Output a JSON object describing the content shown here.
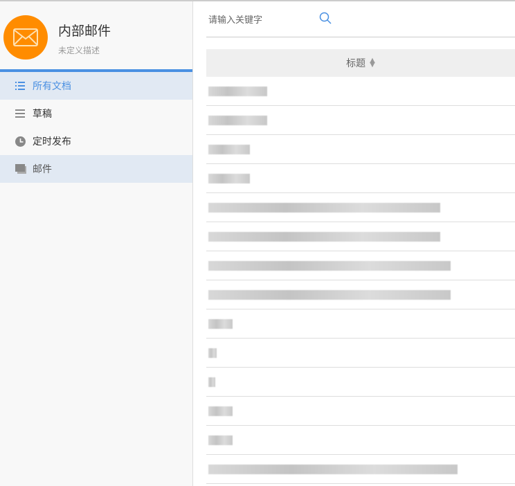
{
  "app": {
    "title": "内部邮件",
    "description": "未定义描述"
  },
  "sidebar": {
    "items": [
      {
        "label": "所有文档",
        "icon": "list-icon"
      },
      {
        "label": "草稿",
        "icon": "menu-icon"
      },
      {
        "label": "定时发布",
        "icon": "clock-icon"
      },
      {
        "label": "邮件",
        "icon": "folder-icon"
      }
    ]
  },
  "search": {
    "placeholder": "请输入关键字"
  },
  "table": {
    "header": "标题",
    "row_count": 14
  },
  "colors": {
    "accent": "#4a90e2",
    "logo": "#ff8c00"
  }
}
